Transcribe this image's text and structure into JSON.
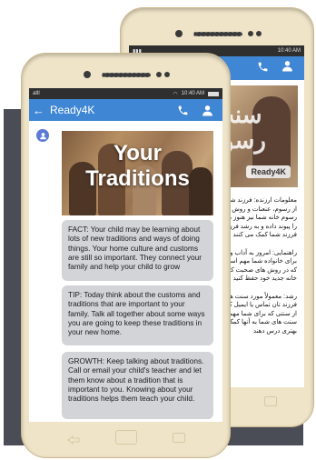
{
  "back_phone": {
    "status_time": "10:40 AM",
    "hero_title": "سنت رسوم",
    "brand": "Ready4K",
    "paragraphs": [
      "معلومات ارزنده: فرزند شما ممکن است در مورد تعداد زیادی از رسوم، عنعنات و روش ها جدید را بیاموزد. فرهنگ، آداب و رسوم خانه شما نیز هنوز مهم است. فرهنگ شما خانواده شما را پیوند داده و به رشد فرزند شما کمک می کنند و به رشد فرزند شما کمک می کنند",
      "راهنمایی: امروز به آداب و رسوم و سنت هایی فکر کنید که برای خانواده شما مهم است. با فرزند خود در مورد روش هایی که در روش های صحبت کنید که می توانید این سنت ها را از خانه جدید خود حفظ کنید",
      "رشد: معمولاً مورد سنت های خانوادگی صحبت کنید. با معلم فرزند تان تماس یا ایمیل کنید و به او بگویید در مورد سنت را از سنتی که برای شما مهم است آگاه سازید. دانستن در مورد سنت های شما به آنها کمک می کند تا به فرزند تان به نحو بهتری درس دهند"
    ]
  },
  "front_phone": {
    "status_left": "atll",
    "status_time": "10:40 AM",
    "app_title": "Ready4K",
    "back_arrow": "←",
    "icons": [
      "phone-icon",
      "person-icon"
    ],
    "hero_title_line1": "Your",
    "hero_title_line2": "Traditions",
    "messages": [
      "FACT: Your child may be learning about lots of new traditions and ways of doing things. Your home culture and customs are still so important. They connect your family and help your child to grow",
      "TIP: Today think about the customs and traditions that are important to your family. Talk all together about some ways you are going to keep these traditions in your new home.",
      "GROWTH: Keep talking about traditions. Call or email your child's teacher and let them know about a tradition that is important to you. Knowing about your traditions helps them teach your child."
    ]
  },
  "colors": {
    "appbar": "#3f86d4",
    "phone_body": "#efe4c8",
    "bubble": "#d3d4d8",
    "backdrop": "#4a4d55"
  }
}
